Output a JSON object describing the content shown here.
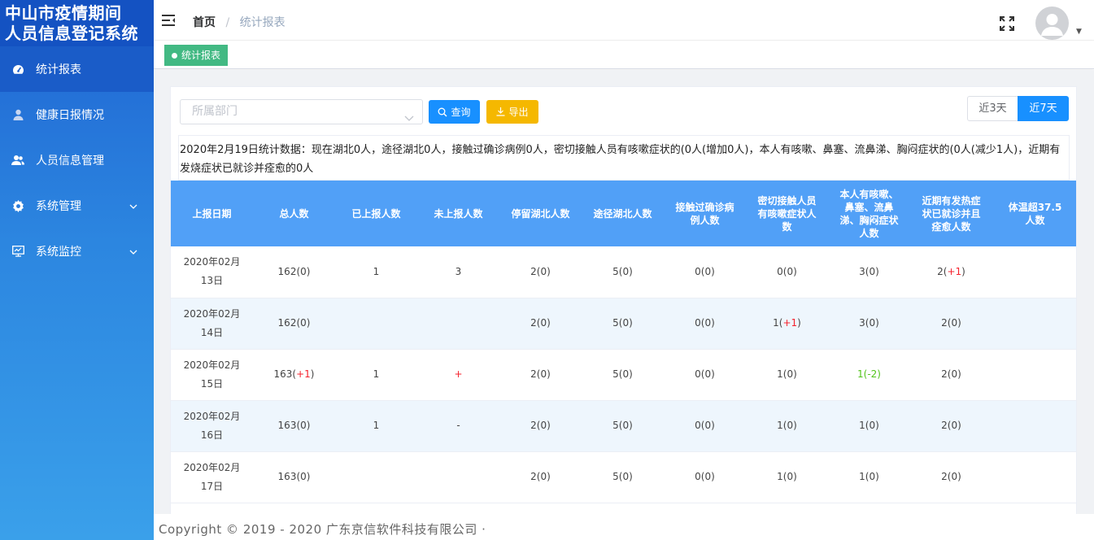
{
  "sidebar": {
    "logo_line1": "中山市疫情期间",
    "logo_line2": "人员信息登记系统",
    "items": [
      {
        "label": "统计报表",
        "icon": "dashboard-icon",
        "active": true
      },
      {
        "label": "健康日报情况",
        "icon": "user-icon"
      },
      {
        "label": "人员信息管理",
        "icon": "users-icon"
      },
      {
        "label": "系统管理",
        "icon": "gear-icon",
        "expandable": true
      },
      {
        "label": "系统监控",
        "icon": "monitor-icon",
        "expandable": true
      }
    ]
  },
  "header": {
    "breadcrumb_home": "首页",
    "breadcrumb_sep": "/",
    "breadcrumb_current": "统计报表"
  },
  "tags": {
    "active_tag": "统计报表"
  },
  "filters": {
    "department_placeholder": "所属部门",
    "query_label": "查询",
    "export_label": "导出",
    "range_3": "近3天",
    "range_7": "近7天",
    "active_range": "近7天"
  },
  "summary": "2020年2月19日统计数据：现在湖北0人，途径湖北0人，接触过确诊病例0人，密切接触人员有咳嗽症状的(0人(增加0人)，本人有咳嗽、鼻塞、流鼻涕、胸闷症状的(0人(减少1人)，近期有发烧症状已就诊并痊愈的0人",
  "table": {
    "headers": [
      "上报日期",
      "总人数",
      "已上报人数",
      "未上报人数",
      "停留湖北人数",
      "途径湖北人数",
      "接触过确诊病例人数",
      "密切接触人员有咳嗽症状人数",
      "本人有咳嗽、鼻塞、流鼻涕、胸闷症状人数",
      "近期有发热症状已就诊并且痊愈人数",
      "体温超37.5人数"
    ],
    "rows": [
      {
        "date": "2020年02月13日",
        "total": "162",
        "total_delta": "(0)",
        "reported": "1",
        "unreported": "3",
        "hubei_stay": "2(0)",
        "hubei_pass": "5(0)",
        "contact": "0(0)",
        "close_cough_base": "0(0)",
        "close_cough_delta": "",
        "self_sym": "3(0)",
        "fever_base": "2(",
        "fever_delta": "+1",
        "fever_end": ")",
        "temp": ""
      },
      {
        "date": "2020年02月14日",
        "total": "162",
        "total_delta": "(0)",
        "reported": "",
        "unreported": "",
        "hubei_stay": "2(0)",
        "hubei_pass": "5(0)",
        "contact": "0(0)",
        "close_cough_base": "1(",
        "close_cough_delta": "+1",
        "self_sym": "3(0)",
        "fever_base": "2(0)",
        "fever_delta": "",
        "fever_end": "",
        "temp": ""
      },
      {
        "date": "2020年02月15日",
        "total": "163",
        "total_delta": "(+1)",
        "reported": "1",
        "unreported": "+",
        "hubei_stay": "2(0)",
        "hubei_pass": "5(0)",
        "contact": "0(0)",
        "close_cough_base": "1(0)",
        "close_cough_delta": "",
        "self_sym": "1(-2)",
        "fever_base": "2(0)",
        "fever_delta": "",
        "fever_end": "",
        "temp": ""
      },
      {
        "date": "2020年02月16日",
        "total": "163",
        "total_delta": "(0)",
        "reported": "1",
        "unreported": "-",
        "hubei_stay": "2(0)",
        "hubei_pass": "5(0)",
        "contact": "0(0)",
        "close_cough_base": "1(0)",
        "close_cough_delta": "",
        "self_sym": "1(0)",
        "fever_base": "2(0)",
        "fever_delta": "",
        "fever_end": "",
        "temp": ""
      },
      {
        "date": "2020年02月17日",
        "total": "163",
        "total_delta": "(0)",
        "reported": "",
        "unreported": "",
        "hubei_stay": "2(0)",
        "hubei_pass": "5(0)",
        "contact": "0(0)",
        "close_cough_base": "1(0)",
        "close_cough_delta": "",
        "self_sym": "1(0)",
        "fever_base": "2(0)",
        "fever_delta": "",
        "fever_end": "",
        "temp": ""
      }
    ]
  },
  "footer": "Copyright © 2019 - 2020    广东京信软件科技有限公司 ·"
}
